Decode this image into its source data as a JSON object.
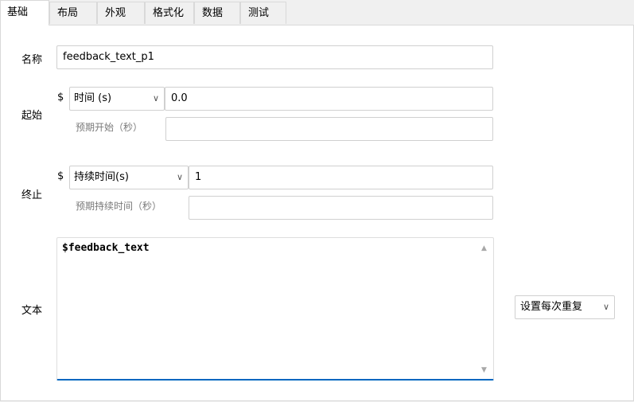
{
  "tabs": [
    "基础",
    "布局",
    "外观",
    "格式化",
    "数据",
    "测试"
  ],
  "fields": {
    "name_label": "名称",
    "name_value": "feedback_text_p1",
    "start_label": "起始",
    "start_dollar": "$",
    "start_type": "时间 (s)",
    "start_value": "0.0",
    "start_expected_label": "预期开始（秒）",
    "start_expected_value": "",
    "stop_label": "终止",
    "stop_dollar": "$",
    "stop_type": "持续时间(s)",
    "stop_value": "1",
    "stop_expected_label": "预期持续时间（秒）",
    "stop_expected_value": "",
    "text_label": "文本",
    "text_value": "$feedback_text",
    "repeat_option": "设置每次重复"
  },
  "icons": {
    "dropdown": "chevron-down-icon",
    "scroll_up": "scroll-up-arrow-icon",
    "scroll_down": "scroll-down-arrow-icon"
  },
  "colors": {
    "accent": "#0067c0"
  }
}
